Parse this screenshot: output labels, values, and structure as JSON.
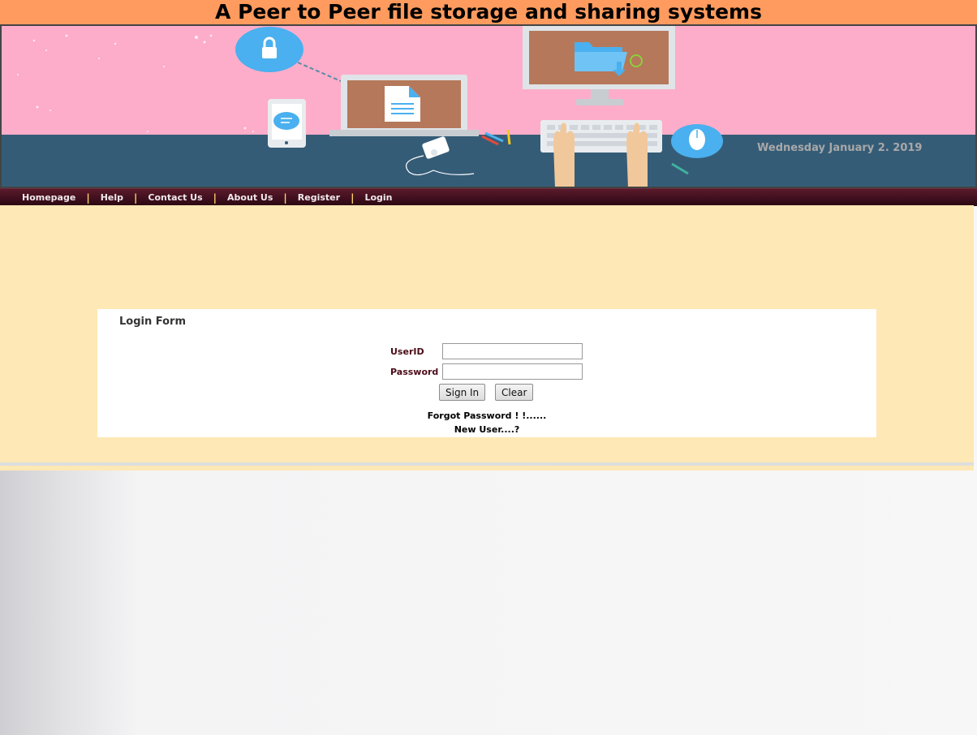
{
  "page": {
    "title": "A Peer to Peer file storage and sharing systems"
  },
  "banner": {
    "date": "Wednesday January 2. 2019",
    "colors": {
      "sky": "#fdadc9",
      "desk": "#355c77"
    }
  },
  "nav": {
    "items": [
      {
        "label": "Homepage"
      },
      {
        "label": "Help"
      },
      {
        "label": "Contact Us"
      },
      {
        "label": "About Us"
      },
      {
        "label": "Register"
      },
      {
        "label": "Login"
      }
    ],
    "separator": "|"
  },
  "login": {
    "title": "Login Form",
    "userid_label": "UserID",
    "userid_value": "",
    "password_label": "Password",
    "password_value": "",
    "signin_label": "Sign In",
    "clear_label": "Clear",
    "forgot_text": "Forgot Password ! !......",
    "new_user_text": "New User....?"
  },
  "colors": {
    "title_bar": "#ff9b5e",
    "nav_bg": "#3d0f1d",
    "content_bg": "#fee8b5",
    "label_color": "#4a0b17"
  }
}
